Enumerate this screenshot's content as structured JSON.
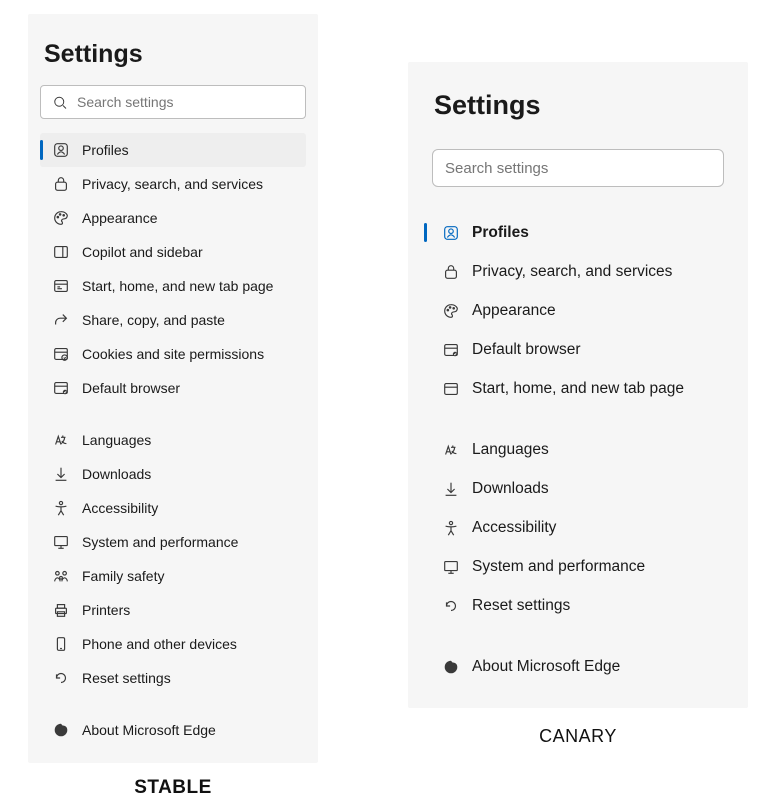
{
  "left": {
    "title": "Settings",
    "search_placeholder": "Search settings",
    "caption": "STABLE",
    "groups": [
      [
        {
          "icon": "profiles",
          "label": "Profiles",
          "selected": true,
          "name": "nav-profiles"
        },
        {
          "icon": "privacy",
          "label": "Privacy, search, and services",
          "name": "nav-privacy"
        },
        {
          "icon": "appearance",
          "label": "Appearance",
          "name": "nav-appearance"
        },
        {
          "icon": "sidebar",
          "label": "Copilot and sidebar",
          "name": "nav-copilot-sidebar"
        },
        {
          "icon": "start",
          "label": "Start, home, and new tab page",
          "name": "nav-start-home"
        },
        {
          "icon": "share",
          "label": "Share, copy, and paste",
          "name": "nav-share-copy-paste"
        },
        {
          "icon": "cookies",
          "label": "Cookies and site permissions",
          "name": "nav-cookies-permissions"
        },
        {
          "icon": "default-browser",
          "label": "Default browser",
          "name": "nav-default-browser"
        }
      ],
      [
        {
          "icon": "languages",
          "label": "Languages",
          "name": "nav-languages"
        },
        {
          "icon": "downloads",
          "label": "Downloads",
          "name": "nav-downloads"
        },
        {
          "icon": "accessibility",
          "label": "Accessibility",
          "name": "nav-accessibility"
        },
        {
          "icon": "system",
          "label": "System and performance",
          "name": "nav-system"
        },
        {
          "icon": "family",
          "label": "Family safety",
          "name": "nav-family"
        },
        {
          "icon": "printers",
          "label": "Printers",
          "name": "nav-printers"
        },
        {
          "icon": "phone",
          "label": "Phone and other devices",
          "name": "nav-phone"
        },
        {
          "icon": "reset",
          "label": "Reset settings",
          "name": "nav-reset"
        }
      ],
      [
        {
          "icon": "edge",
          "label": "About Microsoft Edge",
          "name": "nav-about-edge"
        }
      ]
    ]
  },
  "right": {
    "title": "Settings",
    "search_placeholder": "Search settings",
    "caption": "CANARY",
    "groups": [
      [
        {
          "icon": "profiles",
          "label": "Profiles",
          "selected": true,
          "name": "nav-profiles"
        },
        {
          "icon": "privacy",
          "label": "Privacy, search, and services",
          "name": "nav-privacy"
        },
        {
          "icon": "appearance",
          "label": "Appearance",
          "name": "nav-appearance"
        },
        {
          "icon": "default-browser",
          "label": "Default browser",
          "name": "nav-default-browser"
        },
        {
          "icon": "start-alt",
          "label": "Start, home, and new tab page",
          "name": "nav-start-home"
        }
      ],
      [
        {
          "icon": "languages",
          "label": "Languages",
          "name": "nav-languages"
        },
        {
          "icon": "downloads",
          "label": "Downloads",
          "name": "nav-downloads"
        },
        {
          "icon": "accessibility",
          "label": "Accessibility",
          "name": "nav-accessibility"
        },
        {
          "icon": "system",
          "label": "System and performance",
          "name": "nav-system"
        },
        {
          "icon": "reset",
          "label": "Reset settings",
          "name": "nav-reset"
        }
      ],
      [
        {
          "icon": "edge",
          "label": "About Microsoft Edge",
          "name": "nav-about-edge"
        }
      ]
    ]
  }
}
